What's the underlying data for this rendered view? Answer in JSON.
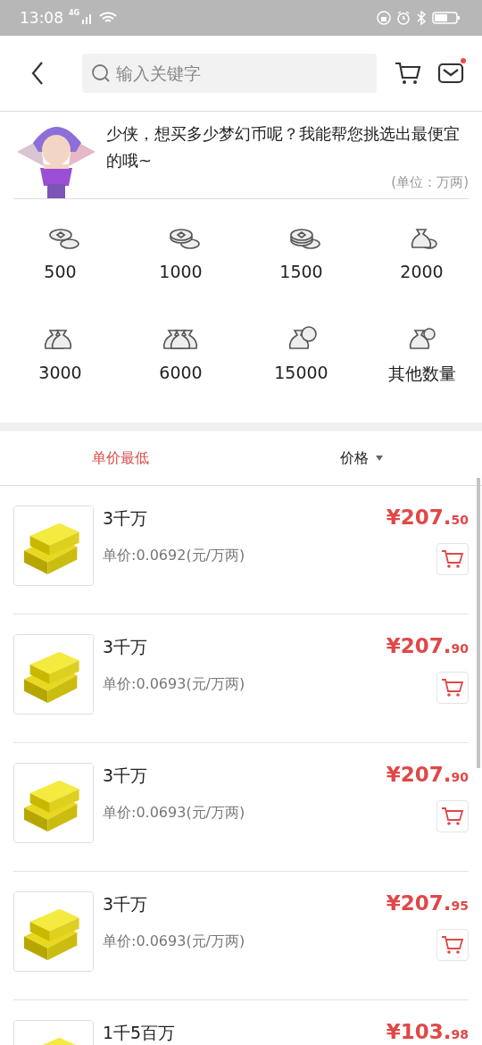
{
  "status_bar": {
    "time": "13:08",
    "network": "4G"
  },
  "header": {
    "search": {
      "placeholder": "输入关键字"
    },
    "mail_unread": true
  },
  "intro": {
    "message": "少侠，想买多少梦幻币呢？我能帮您挑选出最便宜的哦~",
    "unit": "(单位：万两)"
  },
  "amounts": [
    {
      "label": "500",
      "kind": "coins2"
    },
    {
      "label": "1000",
      "kind": "coins3"
    },
    {
      "label": "1500",
      "kind": "coins4"
    },
    {
      "label": "2000",
      "kind": "bag"
    },
    {
      "label": "3000",
      "kind": "bag2"
    },
    {
      "label": "6000",
      "kind": "bag3"
    },
    {
      "label": "15000",
      "kind": "bagmax"
    },
    {
      "label": "其他数量",
      "kind": "bagq"
    }
  ],
  "sort_tabs": [
    {
      "label": "单价最低",
      "selected": true,
      "dropdown": false
    },
    {
      "label": "价格",
      "selected": false,
      "dropdown": true
    }
  ],
  "items": [
    {
      "title": "3千万",
      "unit_price": "单价:0.0692(元/万两)",
      "price": "¥207.",
      "cents": "50"
    },
    {
      "title": "3千万",
      "unit_price": "单价:0.0693(元/万两)",
      "price": "¥207.",
      "cents": "90"
    },
    {
      "title": "3千万",
      "unit_price": "单价:0.0693(元/万两)",
      "price": "¥207.",
      "cents": "90"
    },
    {
      "title": "3千万",
      "unit_price": "单价:0.0693(元/万两)",
      "price": "¥207.",
      "cents": "95"
    },
    {
      "title": "1千5百万",
      "price": "¥103.",
      "cents": "98"
    }
  ]
}
